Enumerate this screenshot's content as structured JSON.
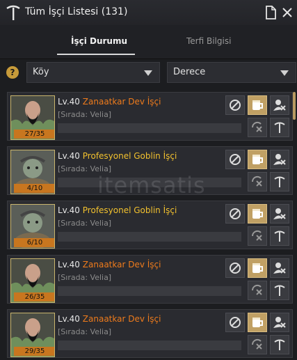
{
  "window": {
    "title": "Tüm İşçi Listesi (131)"
  },
  "tabs": [
    {
      "label": "İşçi Durumu",
      "active": true
    },
    {
      "label": "Terfi Bilgisi",
      "active": false
    }
  ],
  "filters": {
    "help_label": "?",
    "location": "Köy",
    "sort": "Derece"
  },
  "colors": {
    "orange_name": "#ee7b1c",
    "yellow_name": "#f2c12e",
    "gold_button": "#c0a064",
    "stamina": "#c8761f"
  },
  "workers": [
    {
      "level": "Lv.40",
      "name": "Zanaatkar Dev İşçi",
      "grade": "orange",
      "queue": "[Sırada: Velia]",
      "stamina": "27/35",
      "race": "giant"
    },
    {
      "level": "Lv.40",
      "name": "Profesyonel Goblin İşçi",
      "grade": "yellow",
      "queue": "[Sırada: Velia]",
      "stamina": "4/10",
      "race": "goblin"
    },
    {
      "level": "Lv.40",
      "name": "Profesyonel Goblin İşçi",
      "grade": "yellow",
      "queue": "[Sırada: Velia]",
      "stamina": "6/10",
      "race": "goblin"
    },
    {
      "level": "Lv.40",
      "name": "Zanaatkar Dev İşçi",
      "grade": "orange",
      "queue": "[Sırada: Velia]",
      "stamina": "26/35",
      "race": "giant"
    },
    {
      "level": "Lv.40",
      "name": "Zanaatkar Dev İşçi",
      "grade": "orange",
      "queue": "[Sırada: Velia]",
      "stamina": "29/35",
      "race": "giant"
    }
  ],
  "icons": {
    "rest": "no-entry-icon",
    "feed": "beer-mug-icon",
    "fire": "remove-worker-icon",
    "repeat": "repeat-cancel-icon",
    "upgrade": "upgrade-icon"
  },
  "watermark": "itemsatis"
}
